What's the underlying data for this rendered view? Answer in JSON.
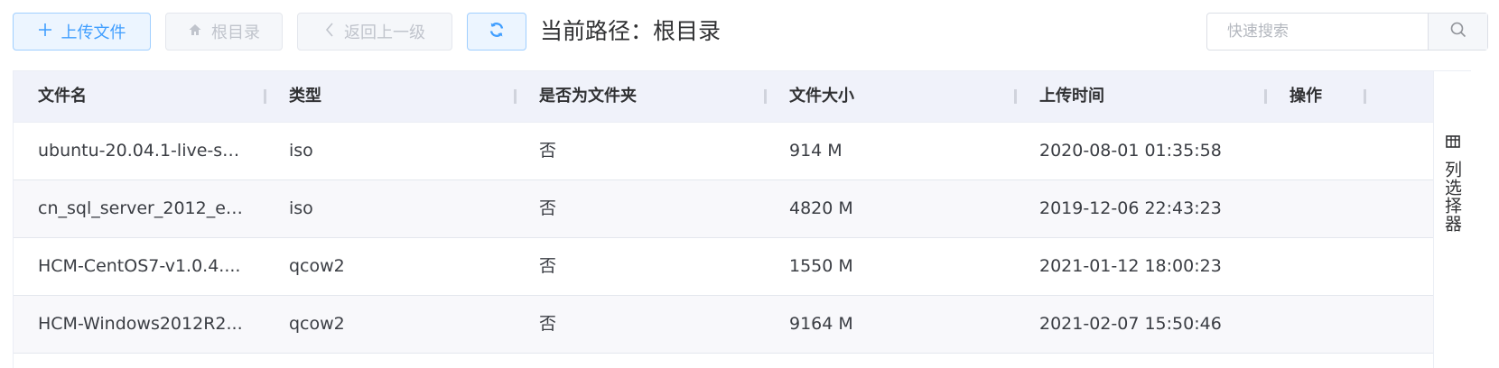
{
  "toolbar": {
    "upload_label": "上传文件",
    "root_label": "根目录",
    "back_label": "返回上一级",
    "path_label": "当前路径：",
    "path_value": "根目录",
    "search_placeholder": "快速搜索"
  },
  "table": {
    "columns": [
      "文件名",
      "类型",
      "是否为文件夹",
      "文件大小",
      "上传时间",
      "操作"
    ],
    "rows": [
      {
        "name": "ubuntu-20.04.1-live-se...",
        "type": "iso",
        "is_folder": "否",
        "size": "914 M",
        "time": "2020-08-01 01:35:58"
      },
      {
        "name": "cn_sql_server_2012_en...",
        "type": "iso",
        "is_folder": "否",
        "size": "4820 M",
        "time": "2019-12-06 22:43:23"
      },
      {
        "name": "HCM-CentOS7-v1.0.4....",
        "type": "qcow2",
        "is_folder": "否",
        "size": "1550 M",
        "time": "2021-01-12 18:00:23"
      },
      {
        "name": "HCM-Windows2012R2...",
        "type": "qcow2",
        "is_folder": "否",
        "size": "9164 M",
        "time": "2021-02-07 15:50:46"
      }
    ]
  },
  "column_selector": {
    "label": "列选择器"
  },
  "colors": {
    "accent": "#409eff",
    "header_bg": "#f0f2fa",
    "disabled": "#c0c4cc"
  }
}
